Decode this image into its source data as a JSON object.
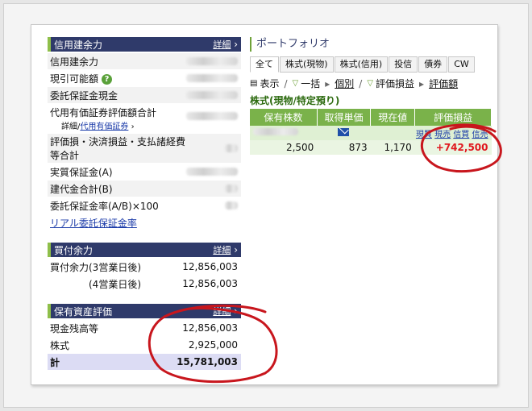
{
  "credit": {
    "title": "信用建余力",
    "more": "詳細",
    "rows": [
      {
        "label": "信用建余力"
      },
      {
        "label": "現引可能額",
        "help": "?"
      },
      {
        "label": "委託保証金現金"
      },
      {
        "label": "代用有価証券評価額合計"
      },
      {
        "label": "評価損・決済損益・支払諸経費等合計"
      },
      {
        "label": "実質保証金(A)"
      },
      {
        "label": "建代金合計(B)"
      },
      {
        "label": "委託保証金率(A/B)×100"
      }
    ],
    "sub_detail": "詳細/",
    "sub_link": "代用有価証券",
    "real_link": "リアル委託保証金率"
  },
  "buying": {
    "title": "買付余力",
    "more": "詳細",
    "rows": [
      {
        "label": "買付余力(3営業日後)",
        "value": "12,856,003"
      },
      {
        "label": "(4営業日後)",
        "value": "12,856,003"
      }
    ]
  },
  "holdings": {
    "title": "保有資産評価",
    "more": "詳細",
    "rows": [
      {
        "label": "現金残高等",
        "value": "12,856,003"
      },
      {
        "label": "株式",
        "value": "2,925,000"
      }
    ],
    "total_label": "計",
    "total_value": "15,781,003"
  },
  "portfolio": {
    "title": "ポートフォリオ",
    "tabs": [
      "全て",
      "株式(現物)",
      "株式(信用)",
      "投信",
      "債券",
      "CW"
    ],
    "toolbar": {
      "display": "表示",
      "bulk": "一括",
      "individual": "個別",
      "eval": "評価損益",
      "eval_rate": "評価額"
    },
    "section": "株式(現物/特定預り)",
    "columns": [
      "保有株数",
      "取得単価",
      "現在値",
      "評価損益"
    ],
    "actions": [
      "現買",
      "現売",
      "信買",
      "信売"
    ],
    "row": {
      "shares": "2,500",
      "cost": "873",
      "price": "1,170",
      "gain": "+742,500"
    }
  }
}
